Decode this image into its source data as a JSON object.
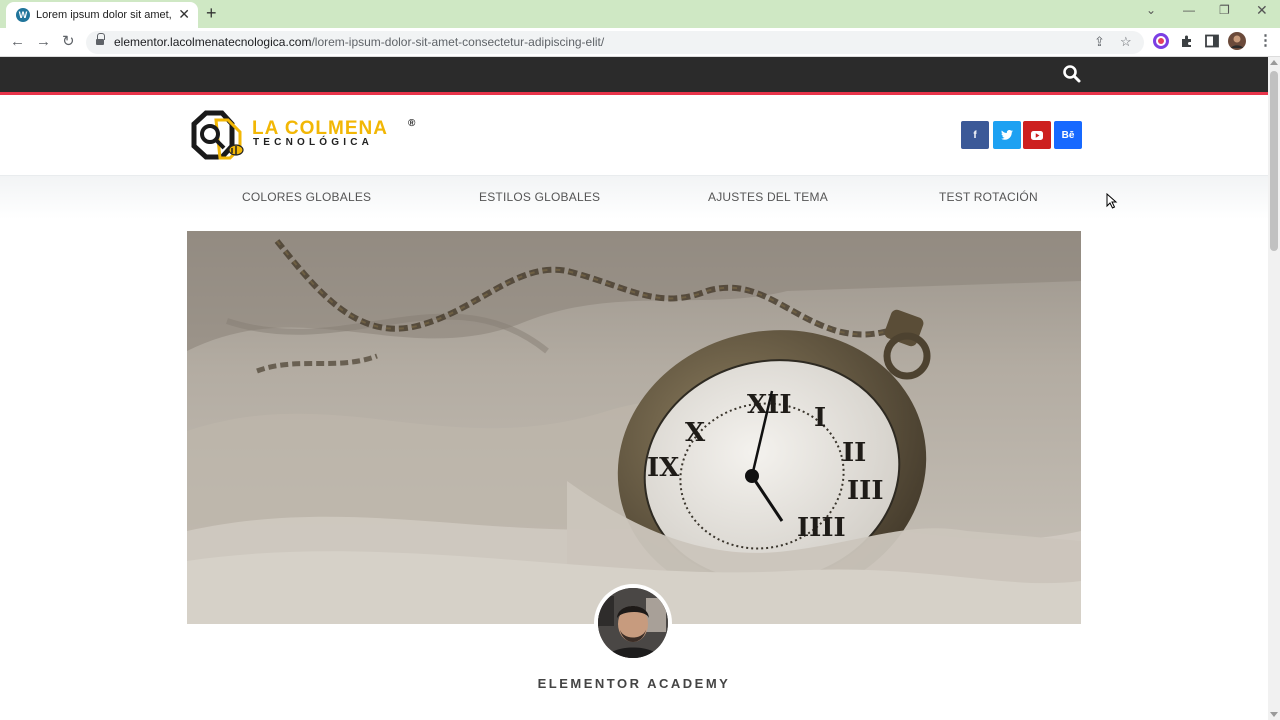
{
  "browser": {
    "tab_title": "Lorem ipsum dolor sit amet, con",
    "favicon": "W",
    "url_domain": "elementor.lacolmenatecnologica.com",
    "url_path": "/lorem-ipsum-dolor-sit-amet-consectetur-adipiscing-elit/"
  },
  "site": {
    "logo_line1": "LA COLMENA",
    "logo_reg": "®",
    "logo_line2": "TECNOLÓGICA",
    "social": [
      {
        "label": "f",
        "icon": "facebook-icon",
        "color": "#3b5998"
      },
      {
        "label": "",
        "icon": "twitter-icon",
        "color": "#1da1f2"
      },
      {
        "label": "",
        "icon": "youtube-icon",
        "color": "#cd201f"
      },
      {
        "label": "Bē",
        "icon": "behance-icon",
        "color": "#1769ff"
      }
    ],
    "menu": [
      "COLORES GLOBALES",
      "ESTILOS GLOBALES",
      "AJUSTES DEL TEMA",
      "TEST ROTACIÓN"
    ],
    "author": "ELEMENTOR ACADEMY"
  },
  "colors": {
    "topbar": "#2b2b2b",
    "accent_line": "#e8344a",
    "logo_yellow": "#f2b705"
  }
}
